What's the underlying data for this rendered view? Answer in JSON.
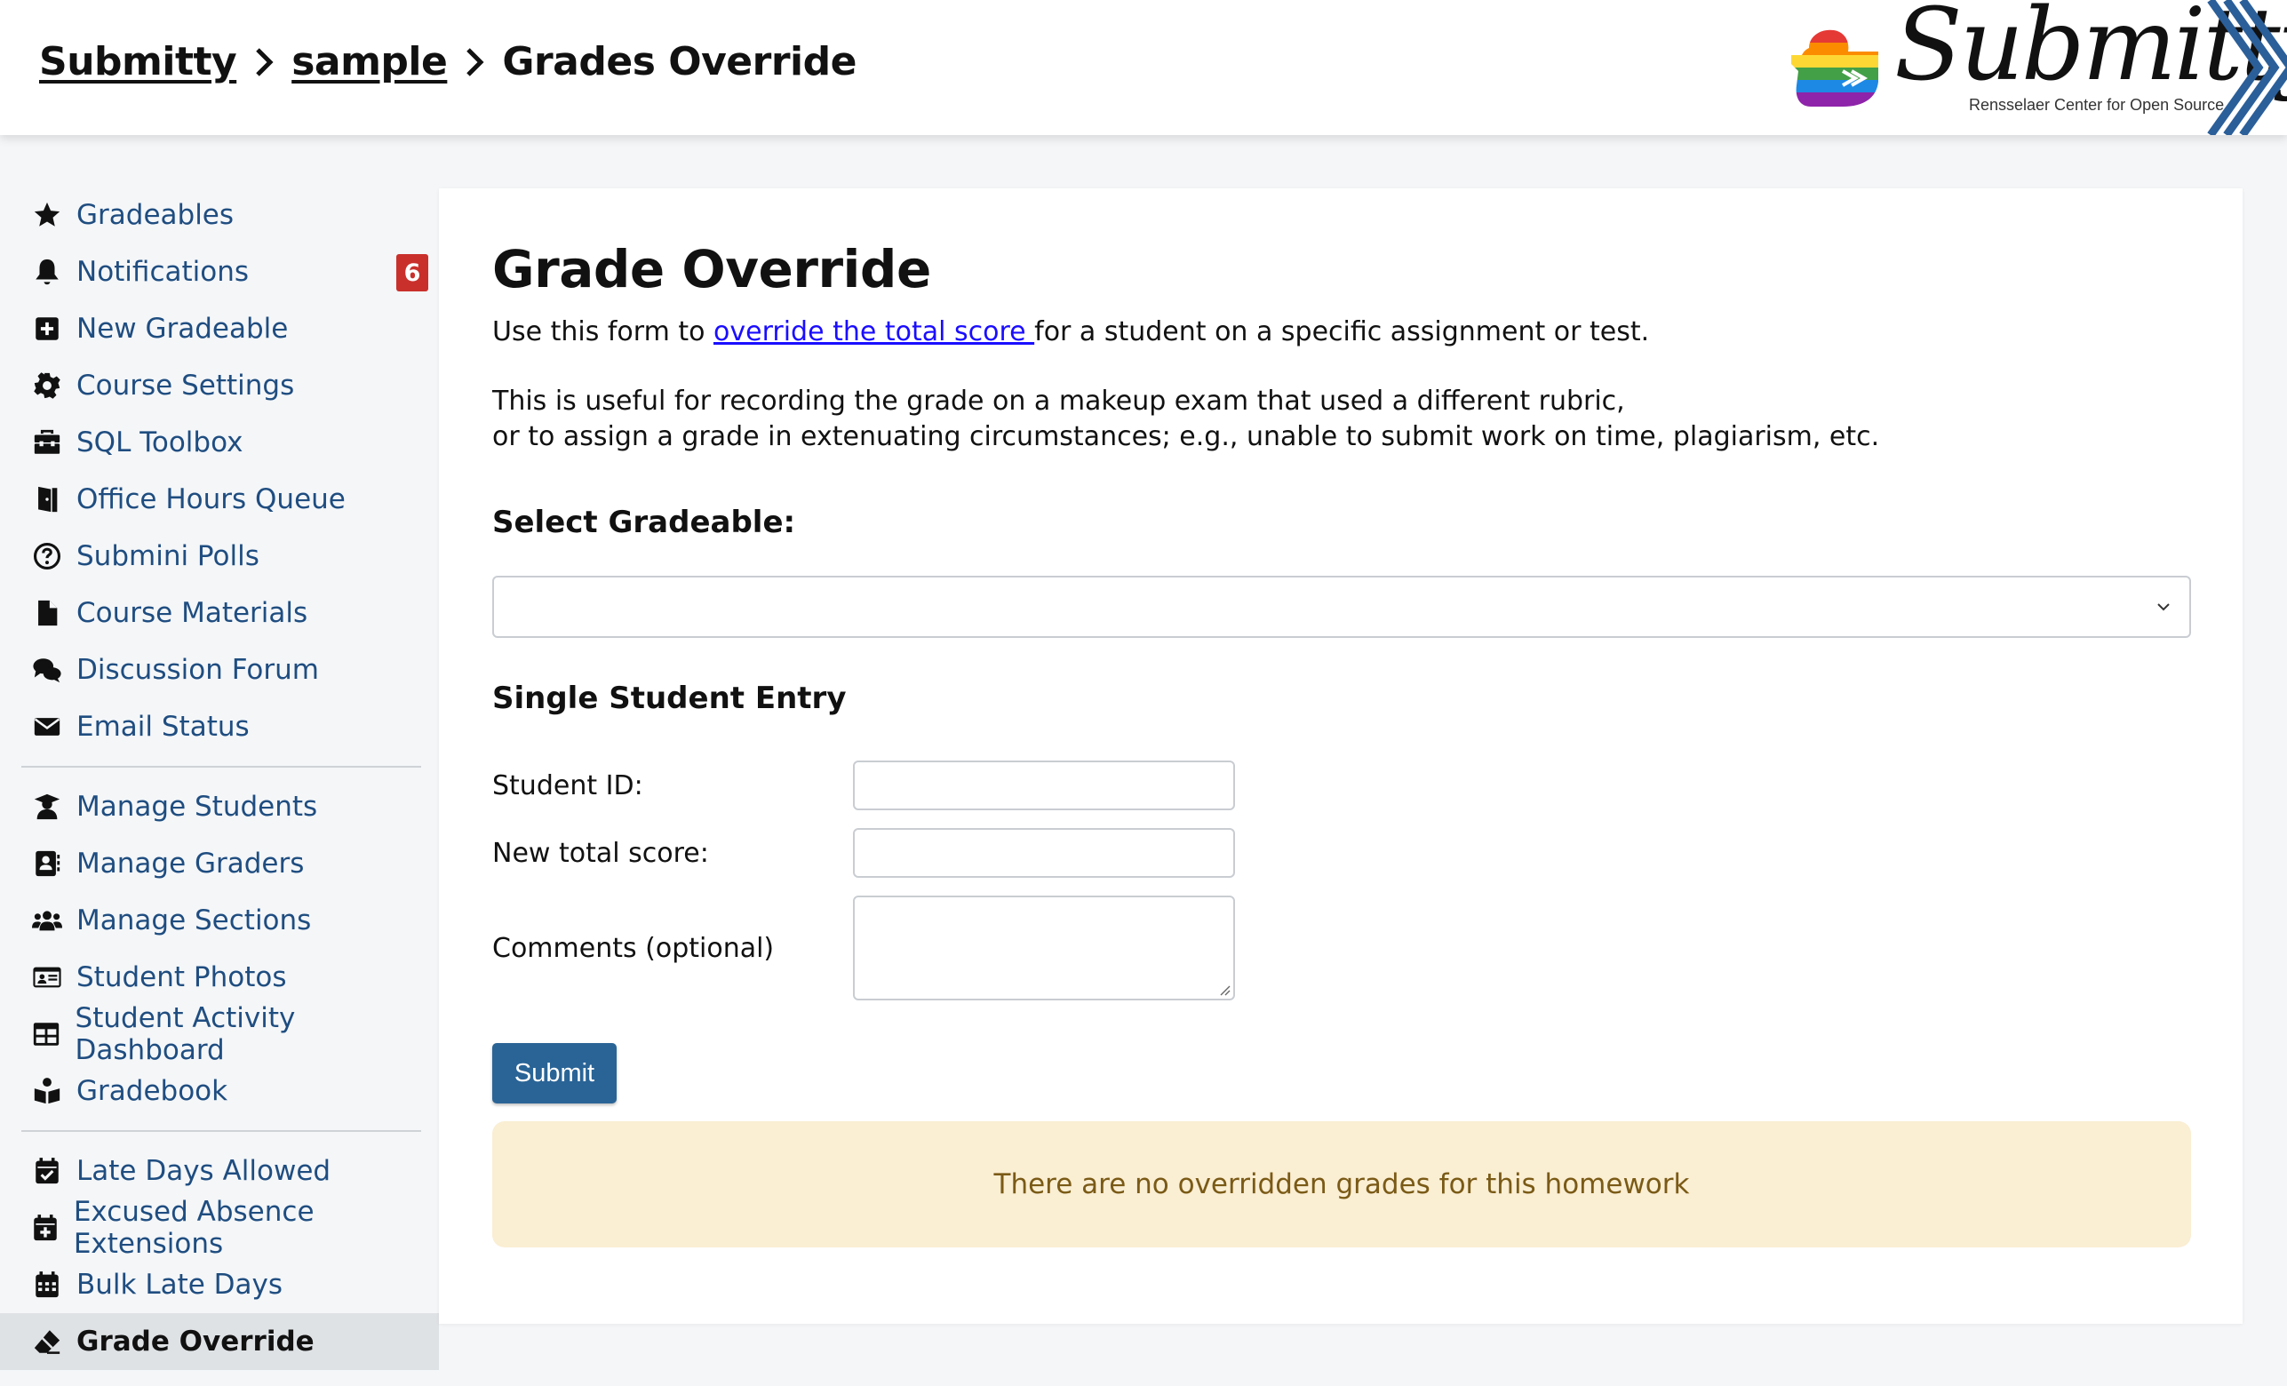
{
  "breadcrumb": {
    "items": [
      "Submitty",
      "sample"
    ],
    "current": "Grades Override"
  },
  "logo": {
    "wordmark": "Submitty",
    "tagline": "Rensselaer Center for Open Source"
  },
  "sidebar": {
    "groups": [
      [
        {
          "label": "Gradeables",
          "icon": "star-icon"
        },
        {
          "label": "Notifications",
          "icon": "bell-icon",
          "badge": "6"
        },
        {
          "label": "New Gradeable",
          "icon": "plus-square-icon"
        },
        {
          "label": "Course Settings",
          "icon": "gear-icon"
        },
        {
          "label": "SQL Toolbox",
          "icon": "toolbox-icon"
        },
        {
          "label": "Office Hours Queue",
          "icon": "door-icon"
        },
        {
          "label": "Submini Polls",
          "icon": "question-circle-icon"
        },
        {
          "label": "Course Materials",
          "icon": "file-icon"
        },
        {
          "label": "Discussion Forum",
          "icon": "comments-icon"
        },
        {
          "label": "Email Status",
          "icon": "envelope-icon"
        }
      ],
      [
        {
          "label": "Manage Students",
          "icon": "user-graduate-icon"
        },
        {
          "label": "Manage Graders",
          "icon": "address-book-icon"
        },
        {
          "label": "Manage Sections",
          "icon": "users-icon"
        },
        {
          "label": "Student Photos",
          "icon": "id-card-icon"
        },
        {
          "label": "Student Activity Dashboard",
          "icon": "table-icon"
        },
        {
          "label": "Gradebook",
          "icon": "book-reader-icon"
        }
      ],
      [
        {
          "label": "Late Days Allowed",
          "icon": "calendar-check-icon"
        },
        {
          "label": "Excused Absence Extensions",
          "icon": "calendar-plus-icon"
        },
        {
          "label": "Bulk Late Days",
          "icon": "calendar-grid-icon"
        },
        {
          "label": "Grade Override",
          "icon": "eraser-icon",
          "active": true
        }
      ]
    ]
  },
  "main": {
    "title": "Grade Override",
    "intro_before": "Use this form to ",
    "intro_link": "override the total score ",
    "intro_after": " for a student on a specific assignment or test.",
    "desc_line1": "This is useful for recording the grade on a makeup exam that used a different rubric,",
    "desc_line2": "or to assign a grade in extenuating circumstances; e.g., unable to submit work on time, plagiarism, etc.",
    "select_label": "Select Gradeable:",
    "select_value": "",
    "section_title": "Single Student Entry",
    "student_id_label": "Student ID:",
    "student_id_value": "",
    "score_label": "New total score:",
    "score_value": "",
    "comments_label": "Comments (optional)",
    "comments_value": "",
    "submit_label": "Submit",
    "empty_message": "There are no overridden grades for this homework"
  },
  "colors": {
    "link": "#1f4d80",
    "badge": "#c9302c",
    "button": "#2a6496",
    "alert_bg": "#faeed3",
    "alert_text": "#7a5a16"
  }
}
